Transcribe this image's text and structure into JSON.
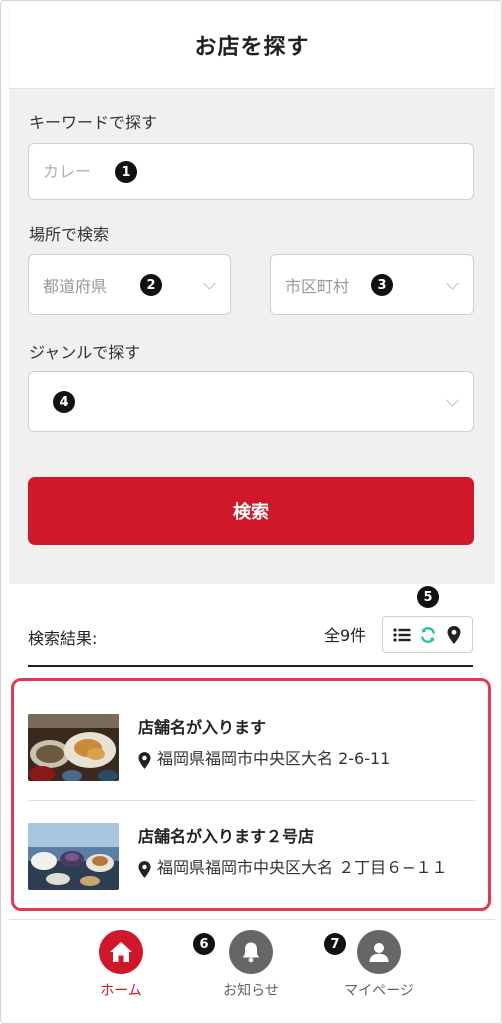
{
  "header": {
    "title": "お店を探す"
  },
  "search": {
    "keyword_label": "キーワードで探す",
    "keyword_placeholder": "カレー",
    "location_label": "場所で検索",
    "prefecture_placeholder": "都道府県",
    "city_placeholder": "市区町村",
    "genre_label": "ジャンルで探す",
    "genre_value": "",
    "search_button": "検索"
  },
  "annotations": {
    "n1": "1",
    "n2": "2",
    "n3": "3",
    "n4": "4",
    "n5": "5",
    "n6": "6",
    "n7": "7"
  },
  "results": {
    "label": "検索結果:",
    "count": "全9件",
    "view_icons": [
      "list-icon",
      "refresh-icon",
      "map-pin-icon"
    ],
    "items": [
      {
        "name": "店舗名が入ります",
        "address": "福岡県福岡市中央区大名 2-6-11"
      },
      {
        "name": "店舗名が入ります２号店",
        "address": "福岡県福岡市中央区大名 ２丁目６−１１"
      }
    ]
  },
  "tabbar": {
    "items": [
      {
        "label": "ホーム",
        "icon": "home-icon",
        "active": true
      },
      {
        "label": "お知らせ",
        "icon": "bell-icon",
        "active": false
      },
      {
        "label": "マイページ",
        "icon": "user-icon",
        "active": false
      }
    ]
  },
  "colors": {
    "accent": "#d0182a",
    "highlight_border": "#e53950",
    "teal": "#2bbfa8",
    "inactive_tab": "#666666",
    "panel_bg": "#f0f0f0"
  }
}
